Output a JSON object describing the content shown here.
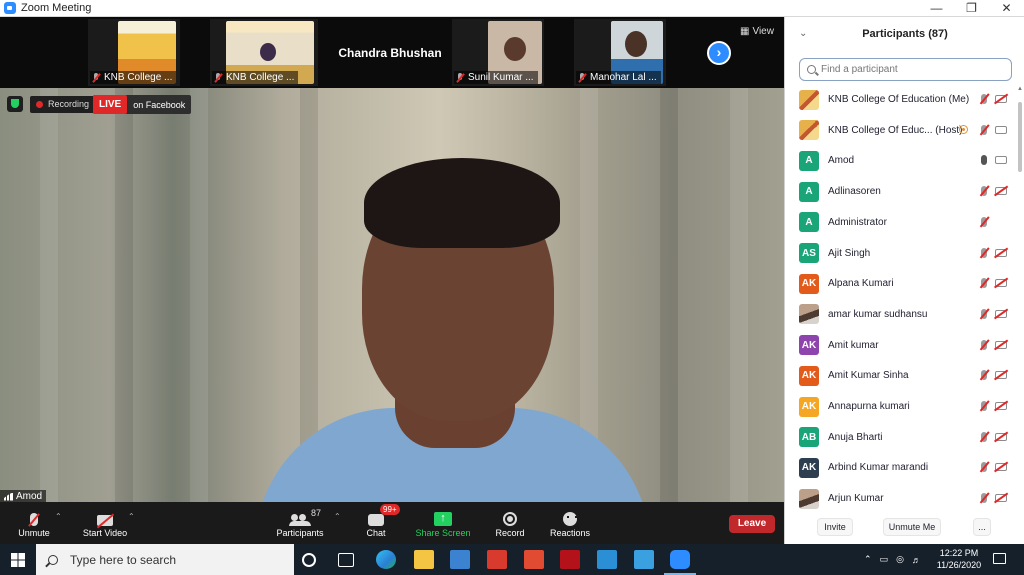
{
  "window": {
    "title": "Zoom Meeting"
  },
  "top_strip": {
    "tiles": [
      {
        "name": "KNB College ..."
      },
      {
        "name": "KNB College ..."
      },
      {
        "name": "Chandra Bhushan"
      },
      {
        "name": "Sunil Kumar ..."
      },
      {
        "name": "Manohar Lal ..."
      }
    ],
    "view_label": "View"
  },
  "speaker": {
    "name": "Amod",
    "recording_label": "Recording",
    "live_label": "LIVE",
    "live_target": "on Facebook"
  },
  "toolbar": {
    "unmute": "Unmute",
    "start_video": "Start Video",
    "participants": "Participants",
    "participants_count": "87",
    "chat": "Chat",
    "chat_badge": "99+",
    "share_screen": "Share Screen",
    "record": "Record",
    "reactions": "Reactions",
    "leave": "Leave"
  },
  "panel": {
    "title": "Participants (87)",
    "search_placeholder": "Find a participant",
    "participants": [
      {
        "initials": "",
        "name": "KNB College Of Education (Me)",
        "avatar_color": "",
        "mic": "muted",
        "video": "off"
      },
      {
        "initials": "",
        "name": "KNB College Of Educ... (Host)",
        "avatar_color": "",
        "mic": "muted",
        "video": "on"
      },
      {
        "initials": "A",
        "name": "Amod",
        "avatar_color": "#1aa579",
        "mic": "on",
        "video": "on"
      },
      {
        "initials": "A",
        "name": "Adlinasoren",
        "avatar_color": "#1aa579",
        "mic": "muted",
        "video": "off"
      },
      {
        "initials": "A",
        "name": "Administrator",
        "avatar_color": "#1aa579",
        "mic": "muted",
        "video": "none"
      },
      {
        "initials": "AS",
        "name": "Ajit Singh",
        "avatar_color": "#1aa579",
        "mic": "muted",
        "video": "off"
      },
      {
        "initials": "AK",
        "name": "Alpana Kumari",
        "avatar_color": "#e25b1a",
        "mic": "muted",
        "video": "off"
      },
      {
        "initials": "",
        "name": "amar kumar sudhansu",
        "avatar_color": "",
        "mic": "muted",
        "video": "off"
      },
      {
        "initials": "AK",
        "name": "Amit kumar",
        "avatar_color": "#8e44ad",
        "mic": "muted",
        "video": "off"
      },
      {
        "initials": "AK",
        "name": "Amit Kumar Sinha",
        "avatar_color": "#e25b1a",
        "mic": "muted",
        "video": "off"
      },
      {
        "initials": "AK",
        "name": "Annapurna kumari",
        "avatar_color": "#f5a623",
        "mic": "muted",
        "video": "off"
      },
      {
        "initials": "AB",
        "name": "Anuja Bharti",
        "avatar_color": "#1aa579",
        "mic": "muted",
        "video": "off"
      },
      {
        "initials": "AK",
        "name": "Arbind Kumar marandi",
        "avatar_color": "#2c3e50",
        "mic": "muted",
        "video": "off"
      },
      {
        "initials": "",
        "name": "Arjun Kumar",
        "avatar_color": "",
        "mic": "muted",
        "video": "off"
      }
    ],
    "footer": {
      "invite": "Invite",
      "unmute_me": "Unmute Me",
      "more": "..."
    }
  },
  "taskbar": {
    "search_placeholder": "Type here to search",
    "time": "12:22 PM",
    "date": "11/26/2020"
  },
  "colors": {
    "accent": "#2d8cff",
    "live_red": "#e02828",
    "share_green": "#23d160",
    "leave_red": "#c0282c"
  }
}
